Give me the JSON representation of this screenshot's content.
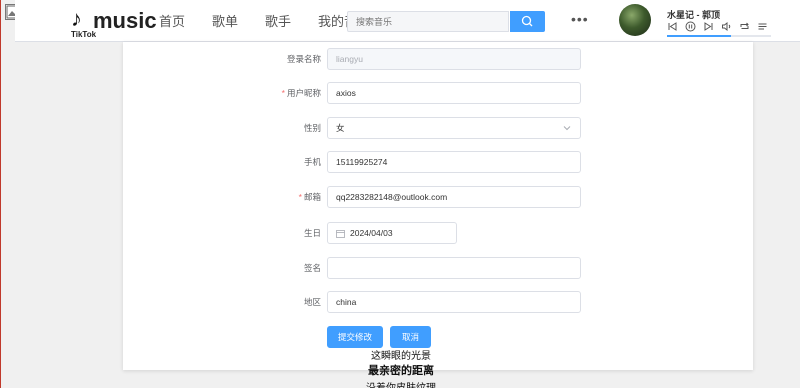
{
  "header": {
    "logo_text": "music",
    "logo_sub": "TikTok",
    "nav": [
      "首页",
      "歌单",
      "歌手",
      "我的音乐"
    ],
    "search_placeholder": "搜索音乐",
    "more": "•••"
  },
  "player": {
    "song": "水星记 - 郭顶",
    "progress": 0.62
  },
  "form": {
    "login_name": {
      "label": "登录名称",
      "value": "liangyu"
    },
    "nickname": {
      "label": "用户昵称",
      "required": "*",
      "value": "axios"
    },
    "gender": {
      "label": "性别",
      "value": "女"
    },
    "phone": {
      "label": "手机",
      "value": "15119925274"
    },
    "email": {
      "label": "邮箱",
      "required": "*",
      "value": "qq2283282148@outlook.com"
    },
    "birthday": {
      "label": "生日",
      "value": "2024/04/03"
    },
    "signature": {
      "label": "签名",
      "value": ""
    },
    "region": {
      "label": "地区",
      "value": "china"
    },
    "submit_label": "提交修改",
    "cancel_label": "取消"
  },
  "lyrics": {
    "prev": "这瞬眼的光景",
    "current": "最亲密的距离",
    "next": "沿着你皮肤纹理"
  },
  "colors": {
    "primary": "#409eff",
    "required": "#f56c6c"
  }
}
